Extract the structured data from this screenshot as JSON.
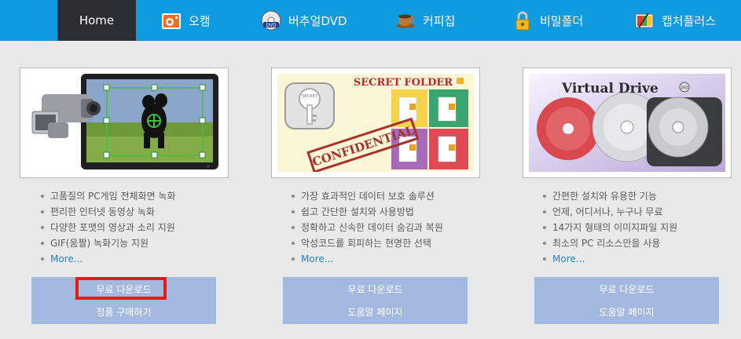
{
  "nav": {
    "items": [
      {
        "label": "Home",
        "icon": "home"
      },
      {
        "label": "오캠",
        "icon": "ocam-icon"
      },
      {
        "label": "버추얼DVD",
        "icon": "dvd-disc-icon"
      },
      {
        "label": "커피집",
        "icon": "coffee-cup-icon"
      },
      {
        "label": "비밀폴더",
        "icon": "padlock-icon"
      },
      {
        "label": "캡처플러스",
        "icon": "capture-plus-icon"
      }
    ],
    "active": "Home"
  },
  "products": [
    {
      "image_alt": "oCam screen recorder",
      "features": [
        "고품질의 PC게임 전체화면 녹화",
        "편리한 인터넷 동영상 녹화",
        "다양한 포맷의 영상과 소리 지원",
        "GIF(움짤) 녹화기능 지원"
      ],
      "more": "More...",
      "buttons": [
        "무료 다운로드",
        "정품 구매하기"
      ]
    },
    {
      "image_title": "SECRET FOLDER",
      "image_stamp": "CONFIDENTIAL",
      "image_key_text": "SECRET",
      "features": [
        "가장 효과적인 데이터 보호 솔루션",
        "쉽고 간단한 설치와 사용방법",
        "정확하고 신속한 데이터 숨김과 복원",
        "악성코드를 회피하는 현명한 선택"
      ],
      "more": "More...",
      "buttons": [
        "무료 다운로드",
        "도움말 페이지"
      ]
    },
    {
      "image_title": "Virtual Drive",
      "image_badge": "DVD",
      "features": [
        "간편한 설치와 유용한 기능",
        "언제, 어디서나, 누구나 무료",
        "14가지 형태의 이미지파일 지원",
        "최소의 PC 리소스만을 사용"
      ],
      "more": "More...",
      "buttons": [
        "무료 다운로드",
        "도움말 페이지"
      ]
    }
  ],
  "colors": {
    "nav_bg": "#0e9be0",
    "nav_active": "#2a2d31",
    "button_panel": "#a4b9e0",
    "highlight": "#e41b17",
    "link": "#2a7fc1"
  }
}
